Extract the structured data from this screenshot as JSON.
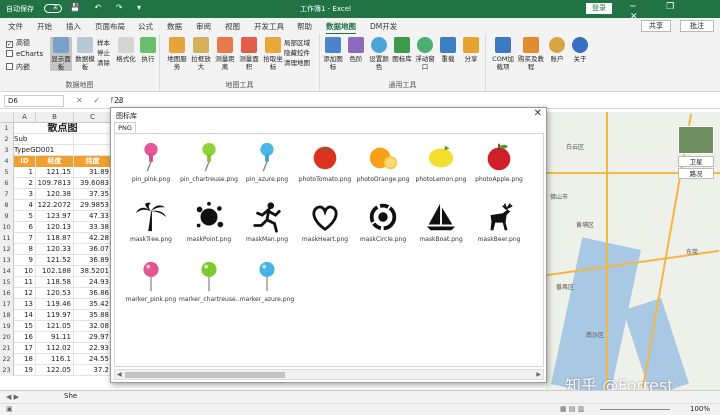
{
  "titlebar": {
    "autosave_label": "自动保存",
    "autosave_state": "关",
    "title": "工作簿1 - Excel",
    "signin_label": "登录",
    "window_buttons": "─ ❐ ✕"
  },
  "tabs": [
    "文件",
    "开始",
    "插入",
    "页面布局",
    "公式",
    "数据",
    "审阅",
    "视图",
    "开发工具",
    "帮助",
    "数据地图",
    "DM开发"
  ],
  "active_tab": "数据地图",
  "share_label": "共享",
  "comment_label": "批注",
  "ribbon": {
    "checks": [
      {
        "label": "高德",
        "checked": true
      },
      {
        "label": "eCharts",
        "checked": false
      },
      {
        "label": "内嵌",
        "checked": false
      }
    ],
    "group1_buttons": [
      "显示面板",
      "数据模板"
    ],
    "group1_small": [
      "样本",
      "停止",
      "清除"
    ],
    "group1_more": [
      "格式化",
      "执行"
    ],
    "group1_label": "数据地图",
    "map_tools_buttons": [
      "地图服务",
      "拉框放大",
      "测量距离",
      "测量面积",
      "拾取坐标"
    ],
    "map_tools_small": [
      "局部区域",
      "隐藏控件",
      "清理地图"
    ],
    "map_tools_label": "地图工具",
    "general_buttons": [
      "添加图标",
      "色阶",
      "设置颜色",
      "图标库",
      "浮动窗口",
      "重载",
      "分享"
    ],
    "general_label": "通用工具",
    "addin_buttons": [
      "COM加载项",
      "购买及教程",
      "账户",
      "关于"
    ]
  },
  "formula_bar": {
    "name_box": "D6",
    "icons": "✕ ✓ fx",
    "value": "23"
  },
  "sheet": {
    "columns": [
      "A",
      "B",
      "C"
    ],
    "title": "散点图",
    "rows": [
      {
        "n": "1",
        "cells": [
          "",
          "散点图",
          ""
        ]
      },
      {
        "n": "2",
        "cells": [
          "Sub",
          "",
          ""
        ]
      },
      {
        "n": "3",
        "cells": [
          "TypeGD001",
          "",
          ""
        ]
      },
      {
        "n": "4",
        "cells": [
          "ID",
          "经度",
          "纬度"
        ]
      },
      {
        "n": "5",
        "cells": [
          "1",
          "121.15",
          "31.89"
        ]
      },
      {
        "n": "6",
        "cells": [
          "2",
          "109.7813",
          "39.6083"
        ]
      },
      {
        "n": "7",
        "cells": [
          "3",
          "120.38",
          "37.35"
        ]
      },
      {
        "n": "8",
        "cells": [
          "4",
          "122.2072",
          "29.9853"
        ]
      },
      {
        "n": "9",
        "cells": [
          "5",
          "123.97",
          "47.33"
        ]
      },
      {
        "n": "10",
        "cells": [
          "6",
          "120.13",
          "33.38"
        ]
      },
      {
        "n": "11",
        "cells": [
          "7",
          "118.87",
          "42.28"
        ]
      },
      {
        "n": "12",
        "cells": [
          "8",
          "120.33",
          "36.07"
        ]
      },
      {
        "n": "13",
        "cells": [
          "9",
          "121.52",
          "36.89"
        ]
      },
      {
        "n": "14",
        "cells": [
          "10",
          "102.188",
          "38.5201"
        ]
      },
      {
        "n": "15",
        "cells": [
          "11",
          "118.58",
          "24.93"
        ]
      },
      {
        "n": "16",
        "cells": [
          "12",
          "120.53",
          "36.86"
        ]
      },
      {
        "n": "17",
        "cells": [
          "13",
          "119.46",
          "35.42"
        ]
      },
      {
        "n": "18",
        "cells": [
          "14",
          "119.97",
          "35.88"
        ]
      },
      {
        "n": "19",
        "cells": [
          "15",
          "121.05",
          "32.08"
        ]
      },
      {
        "n": "20",
        "cells": [
          "16",
          "91.11",
          "29.97"
        ]
      },
      {
        "n": "21",
        "cells": [
          "17",
          "112.02",
          "22.93"
        ]
      },
      {
        "n": "22",
        "cells": [
          "18",
          "116.1",
          "24.55"
        ]
      },
      {
        "n": "23",
        "cells": [
          "19",
          "122.05",
          "37.2"
        ]
      }
    ]
  },
  "sheet_tab_label": "She",
  "status": {
    "zoom": "100%"
  },
  "dialog": {
    "title": "图标库",
    "close": "✕",
    "tab": "PNG",
    "icons": [
      {
        "name": "pin_pink.png",
        "icon": "pin-pink-icon"
      },
      {
        "name": "pin_chartreuse.png",
        "icon": "pin-chartreuse-icon"
      },
      {
        "name": "pin_azure.png",
        "icon": "pin-azure-icon"
      },
      {
        "name": "photoTomato.png",
        "icon": "tomato-icon"
      },
      {
        "name": "photoOrange.png",
        "icon": "orange-icon"
      },
      {
        "name": "photoLemon.png",
        "icon": "lemon-icon"
      },
      {
        "name": "photoApple.png",
        "icon": "apple-icon"
      },
      {
        "name": "maskTree.png",
        "icon": "palm-tree-icon"
      },
      {
        "name": "maskPoint.png",
        "icon": "ink-splat-icon"
      },
      {
        "name": "maskMan.png",
        "icon": "running-man-icon"
      },
      {
        "name": "maskHeart.png",
        "icon": "heart-icon"
      },
      {
        "name": "maskCircle.png",
        "icon": "brush-circle-icon"
      },
      {
        "name": "maskBoat.png",
        "icon": "sailboat-icon"
      },
      {
        "name": "maskBeer.png",
        "icon": "deer-icon"
      },
      {
        "name": "marker_pink.png",
        "icon": "marker-pink-icon"
      },
      {
        "name": "marker_chartreuse...",
        "icon": "marker-chartreuse-icon"
      },
      {
        "name": "marker_azure.png",
        "icon": "marker-azure-icon"
      }
    ]
  },
  "map": {
    "labels": [
      "卫星",
      "路况",
      "黄埔区",
      "东莞",
      "南沙区",
      "白云区",
      "番禺区",
      "佛山市"
    ],
    "watermark": "知乎 @Forrest"
  },
  "colors": {
    "excel_green": "#217346",
    "header_orange": "#f0a030",
    "map_water": "#a9c8e4",
    "map_road": "#f5b642"
  }
}
